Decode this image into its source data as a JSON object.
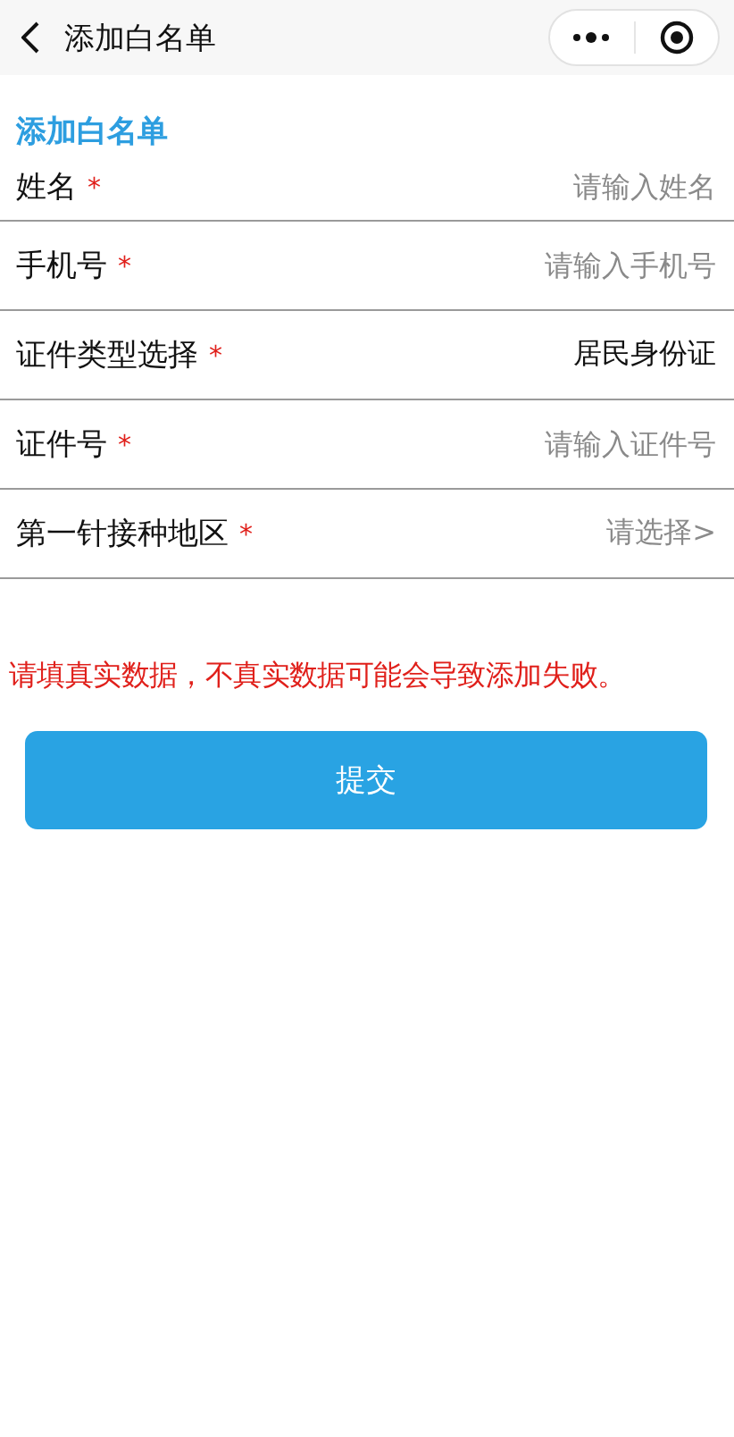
{
  "nav_bar": {
    "title": "添加白名单"
  },
  "section_title": "添加白名单",
  "fields": [
    {
      "kind": "input",
      "label": "姓名",
      "required_mark": "*",
      "placeholder": "请输入姓名"
    },
    {
      "kind": "input",
      "label": "手机号",
      "required_mark": "*",
      "placeholder": "请输入手机号"
    },
    {
      "kind": "select",
      "label": "证件类型选择",
      "required_mark": "*",
      "value": "居民身份证"
    },
    {
      "kind": "input",
      "label": "证件号",
      "required_mark": "*",
      "placeholder": "请输入证件号"
    },
    {
      "kind": "picker",
      "label": "第一针接种地区",
      "required_mark": "*",
      "placeholder": "请选择>"
    }
  ],
  "warning": "请填真实数据，不真实数据可能会导致添加失败。",
  "submit_button": "提交"
}
